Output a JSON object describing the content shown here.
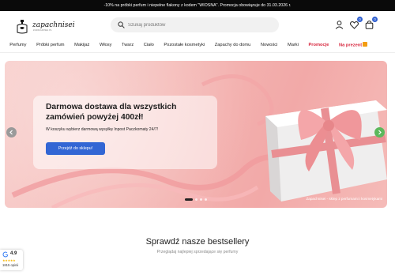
{
  "topbar": {
    "text": "-10% na próbki perfum i niepełne flakony z kodem \"WIOSNA\". Promocja obowiązuje do 31.03.2026 r."
  },
  "header": {
    "logo_text": "zapachnisei",
    "logo_tagline": "ZAPACHNISEI.PL",
    "search": {
      "placeholder": "Szukaj produktów",
      "icon": "search-icon"
    },
    "icons": [
      {
        "name": "user-icon"
      },
      {
        "name": "heart-icon",
        "badge": "0"
      },
      {
        "name": "cart-icon",
        "badge": "0"
      }
    ]
  },
  "nav": {
    "items": [
      {
        "label": "Perfumy",
        "style": "normal"
      },
      {
        "label": "Próbki perfum",
        "style": "normal"
      },
      {
        "label": "Makijaż",
        "style": "normal"
      },
      {
        "label": "Włosy",
        "style": "normal"
      },
      {
        "label": "Twarz",
        "style": "normal"
      },
      {
        "label": "Ciało",
        "style": "normal"
      },
      {
        "label": "Pozostałe kosmetyki",
        "style": "normal"
      },
      {
        "label": "Zapachy do domu",
        "style": "normal"
      },
      {
        "label": "Nowości",
        "style": "normal"
      },
      {
        "label": "Marki",
        "style": "normal"
      },
      {
        "label": "Promocje",
        "style": "promo"
      },
      {
        "label": "Na prezent",
        "style": "gift"
      }
    ]
  },
  "hero": {
    "title": "Darmowa dostawa dla wszystkich zamówień powyżej 400zł!",
    "subtitle": "W koszyku wybierz darmową wysyłkę Inpost Paczkomaty 24/7!",
    "button_label": "Przejdź do sklepu!",
    "caption": "Zapachnisei - sklep z perfumami i kosmetykami",
    "slides_total": 4,
    "slide_active": 1
  },
  "bestsellers": {
    "title": "Sprawdź nasze bestsellery",
    "subtitle": "Przeglądaj najlepiej sprzedające się perfumy"
  },
  "rating": {
    "score": "4.9",
    "stars": "★★★★★",
    "count": "1815 opinii"
  },
  "colors": {
    "accent": "#3266d4",
    "promo": "#d7263d",
    "topbar_bg": "#0a0a0a",
    "hero_bg": "#f4b7b4"
  }
}
